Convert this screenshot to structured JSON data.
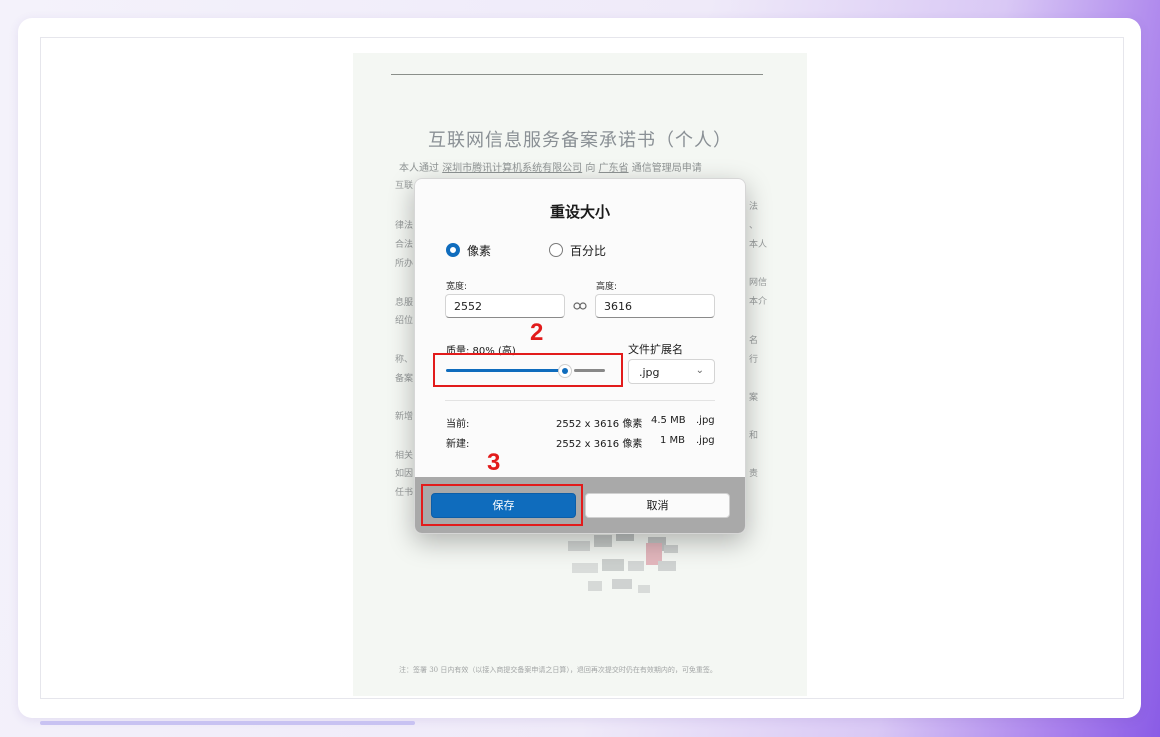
{
  "document": {
    "title": "互联网信息服务备案承诺书（个人）",
    "intro": {
      "prefix": "本人通过",
      "company": "深圳市腾讯计算机系统有限公司",
      "mid": "向",
      "province": "广东省",
      "suffix": "通信管理局申请"
    },
    "left_fragments": [
      "互联",
      "律法",
      "合法",
      "所办",
      "息服",
      "绍位",
      "称、",
      "备案",
      "新增",
      "相关",
      "如因",
      "任书"
    ],
    "right_fragments": [
      "法",
      "、",
      "本人",
      "网信",
      "本介",
      "名",
      "行",
      "案",
      "和",
      "责"
    ],
    "footnote": "注：签署 30 日内有效（以接入商提交备案申请之日算），退回再次提交时仍在有效期内的，可免重签。"
  },
  "dialog": {
    "title": "重设大小",
    "mode_options": [
      {
        "label": "像素",
        "selected": true
      },
      {
        "label": "百分比",
        "selected": false
      }
    ],
    "width_label": "宽度:",
    "width_value": "2552",
    "height_label": "高度:",
    "height_value": "3616",
    "link_icon": "link-icon",
    "quality_label": "质量: 80% (高)",
    "quality_value": 0.8,
    "ext_label": "文件扩展名",
    "ext_value": ".jpg",
    "current": {
      "label": "当前:",
      "dims": "2552 x 3616 像素",
      "size": "4.5 MB",
      "ext": ".jpg"
    },
    "new": {
      "label": "新建:",
      "dims": "2552 x 3616 像素",
      "size": "1 MB",
      "ext": ".jpg"
    },
    "save_label": "保存",
    "cancel_label": "取消"
  },
  "annotations": [
    {
      "number": "2",
      "target": "quality-slider"
    },
    {
      "number": "3",
      "target": "save-button"
    }
  ],
  "colors": {
    "accent": "#0f6cbd",
    "annotation": "#e21b1b"
  }
}
